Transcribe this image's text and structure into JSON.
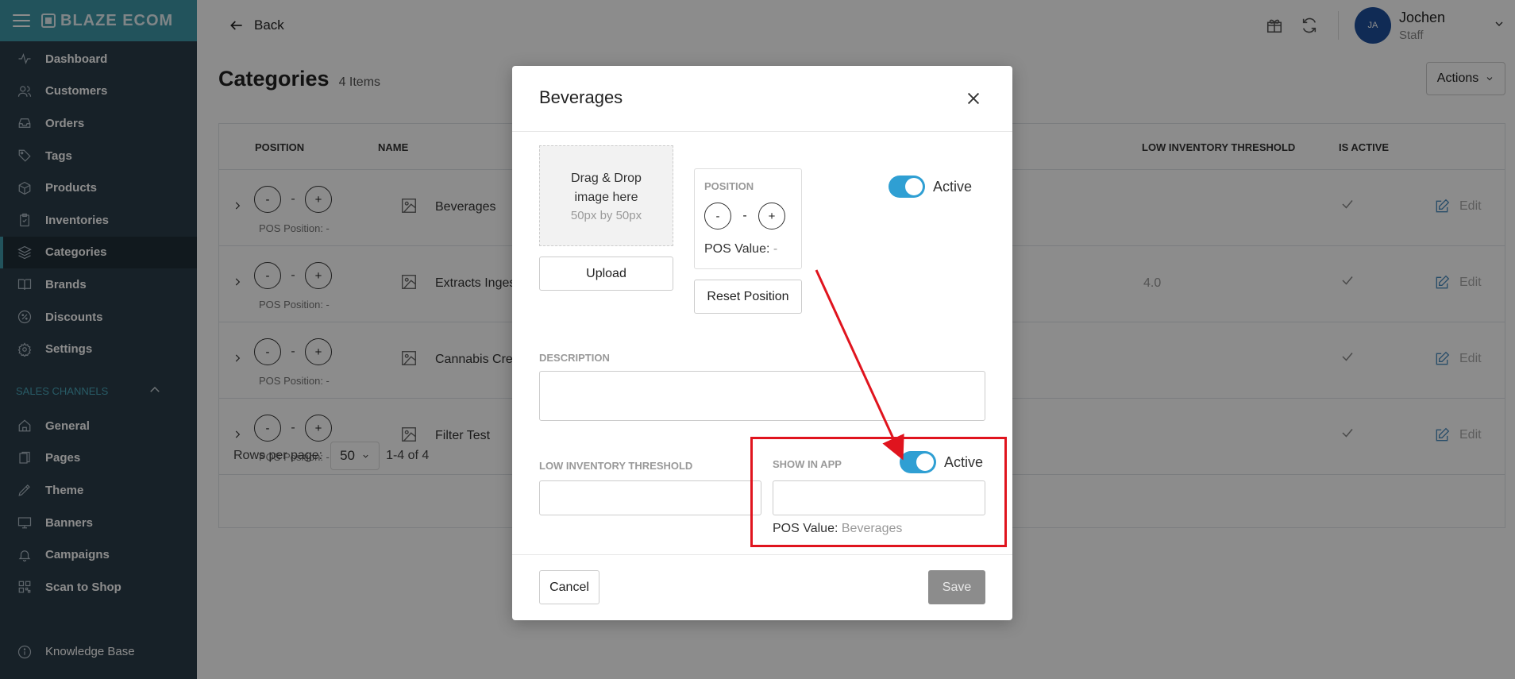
{
  "brand": {
    "name": "BLAZE ECOM"
  },
  "sidebar": {
    "items": [
      {
        "label": "Dashboard",
        "icon": "activity-icon"
      },
      {
        "label": "Customers",
        "icon": "users-icon"
      },
      {
        "label": "Orders",
        "icon": "inbox-icon"
      },
      {
        "label": "Tags",
        "icon": "tag-icon"
      },
      {
        "label": "Products",
        "icon": "box-icon"
      },
      {
        "label": "Inventories",
        "icon": "clipboard-icon"
      },
      {
        "label": "Categories",
        "icon": "layers-icon",
        "active": true
      },
      {
        "label": "Brands",
        "icon": "book-icon"
      },
      {
        "label": "Discounts",
        "icon": "percent-icon"
      },
      {
        "label": "Settings",
        "icon": "gear-icon"
      }
    ],
    "sales_channels_label": "SALES CHANNELS",
    "channel_items": [
      {
        "label": "General",
        "icon": "home-icon"
      },
      {
        "label": "Pages",
        "icon": "pages-icon"
      },
      {
        "label": "Theme",
        "icon": "pen-icon"
      },
      {
        "label": "Banners",
        "icon": "monitor-icon"
      },
      {
        "label": "Campaigns",
        "icon": "bell-icon"
      },
      {
        "label": "Scan to Shop",
        "icon": "qr-icon"
      }
    ],
    "knowledge_base": "Knowledge Base"
  },
  "topbar": {
    "back_label": "Back",
    "user": {
      "initials": "JA",
      "name": "Jochen",
      "role": "Staff"
    }
  },
  "page": {
    "title": "Categories",
    "count": "4 Items",
    "actions_label": "Actions"
  },
  "table": {
    "headers": {
      "position": "POSITION",
      "name": "NAME",
      "low_inventory": "LOW INVENTORY THRESHOLD",
      "is_active": "IS ACTIVE"
    },
    "rows": [
      {
        "name": "Beverages",
        "pos_label": "POS Position: -",
        "low": ""
      },
      {
        "name": "Extracts Inges",
        "pos_label": "POS Position: -",
        "low": "4.0"
      },
      {
        "name": "Cannabis Crea",
        "pos_label": "POS Position: -",
        "low": ""
      },
      {
        "name": "Filter Test",
        "pos_label": "POS Position: -",
        "low": ""
      }
    ],
    "minus": "-",
    "plus": "+",
    "dash": "-",
    "edit_label": "Edit",
    "rows_per_page_label": "Rows per page:",
    "rows_per_page": "50",
    "range": "1-4 of 4"
  },
  "modal": {
    "title": "Beverages",
    "dropzone_text": "Drag & Drop image here",
    "dropzone_hint": "50px by 50px",
    "upload_label": "Upload",
    "position_label": "POSITION",
    "pos_value_label": "POS Value:",
    "pos_value": "-",
    "reset_label": "Reset Position",
    "active_label": "Active",
    "description_label": "DESCRIPTION",
    "low_inventory_label": "LOW INVENTORY THRESHOLD",
    "show_in_app_label": "SHOW IN APP",
    "show_in_app_active": "Active",
    "show_pos_value_label": "POS Value:",
    "show_pos_value": "Beverages",
    "cancel_label": "Cancel",
    "save_label": "Save"
  },
  "colors": {
    "accent": "#2f9fd3",
    "sidebar_bg": "#2b3d4a",
    "brand_bar": "#3f97a8",
    "annotation": "#e0141e"
  }
}
